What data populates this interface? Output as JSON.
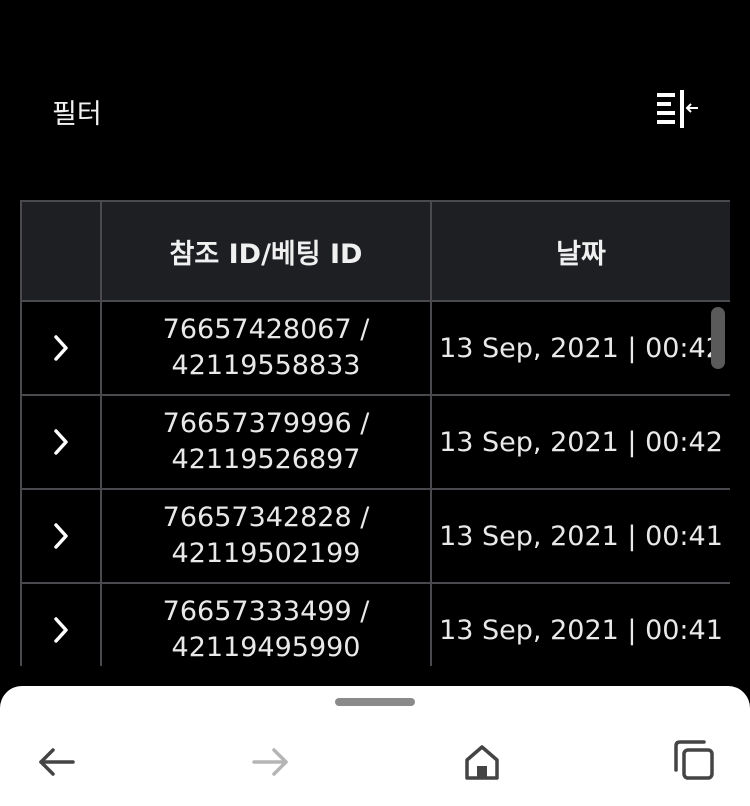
{
  "filter": {
    "label": "필터"
  },
  "table": {
    "headers": [
      "",
      "참조 ID/베팅 ID",
      "날짜"
    ],
    "rows": [
      {
        "ref_id": "76657428067 /",
        "bet_id": "42119558833",
        "date": "13 Sep, 2021 | 00:42"
      },
      {
        "ref_id": "76657379996 /",
        "bet_id": "42119526897",
        "date": "13 Sep, 2021 | 00:42"
      },
      {
        "ref_id": "76657342828 /",
        "bet_id": "42119502199",
        "date": "13 Sep, 2021 | 00:41"
      },
      {
        "ref_id": "76657333499 /",
        "bet_id": "42119495990",
        "date": "13 Sep, 2021 | 00:41"
      }
    ]
  },
  "icons": {
    "filter": "filter-collapse-icon",
    "expand": "chevron-right-icon",
    "back": "arrow-left-icon",
    "forward": "arrow-right-icon",
    "home": "home-icon",
    "tabs": "tabs-icon"
  },
  "colors": {
    "background": "#000000",
    "header_cell": "#1e1f23",
    "border": "#4a4a4e",
    "text": "#ffffff",
    "bottom_bar": "#ffffff"
  }
}
